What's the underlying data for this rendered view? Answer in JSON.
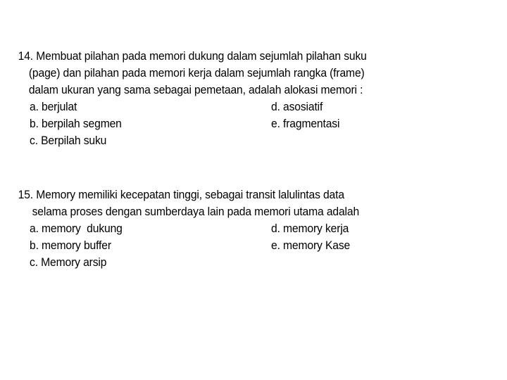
{
  "slide": {
    "background_color": "#ffffff",
    "text_color": "#000000",
    "questions": [
      {
        "number": "14.",
        "stem_lines": [
          "14. Membuat pilahan pada memori dukung dalam sejumlah pilahan suku",
          "(page) dan pilahan pada memori kerja dalam sejumlah rangka (frame)",
          "dalam ukuran yang sama sebagai pemetaan, adalah alokasi memori :"
        ],
        "options_left": [
          "a. berjulat",
          "b. berpilah segmen",
          "c. Berpilah suku"
        ],
        "options_right": [
          "d. asosiatif",
          "e. fragmentasi"
        ]
      },
      {
        "number": "15.",
        "stem_lines": [
          "15. Memory memiliki kecepatan tinggi, sebagai transit lalulintas data",
          "selama proses dengan sumberdaya lain pada memori utama adalah"
        ],
        "options_left": [
          "a. memory  dukung",
          "b. memory buffer",
          "c. Memory arsip"
        ],
        "options_right": [
          "d. memory kerja",
          "e. memory Kase"
        ]
      }
    ]
  }
}
